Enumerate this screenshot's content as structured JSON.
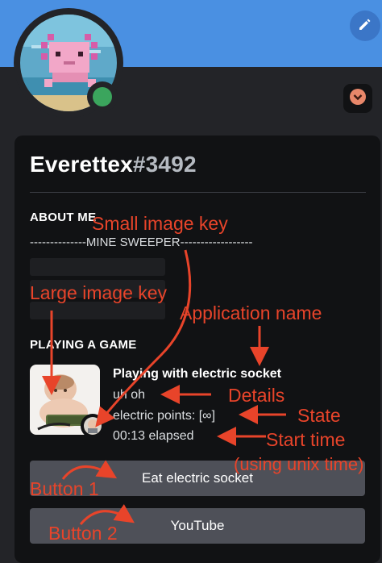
{
  "profile": {
    "username": "Everettex",
    "discriminator": "#3492",
    "status_color": "#3ba55d"
  },
  "about": {
    "title": "ABOUT ME",
    "bio_line": "--------------MINE SWEEPER------------------"
  },
  "activity": {
    "title": "PLAYING A GAME",
    "app_name": "Playing with electric socket",
    "details": "uh oh",
    "state": "electric points: [∞]",
    "elapsed": "00:13 elapsed"
  },
  "buttons": [
    {
      "label": "Eat electric socket"
    },
    {
      "label": "YouTube"
    }
  ],
  "annotations": {
    "small_image_key": "Small image key",
    "large_image_key": "Large image key",
    "application_name": "Application name",
    "details": "Details",
    "state": "State",
    "start_time": "Start time",
    "start_time_note": "(using unix time)",
    "button1": "Button 1",
    "button2": "Button 2"
  },
  "colors": {
    "banner": "#4a90e2",
    "annotation": "#e8442a",
    "button": "#4e5058"
  },
  "icons": [
    "pencil-icon",
    "chevron-down-icon",
    "online-status-icon"
  ]
}
